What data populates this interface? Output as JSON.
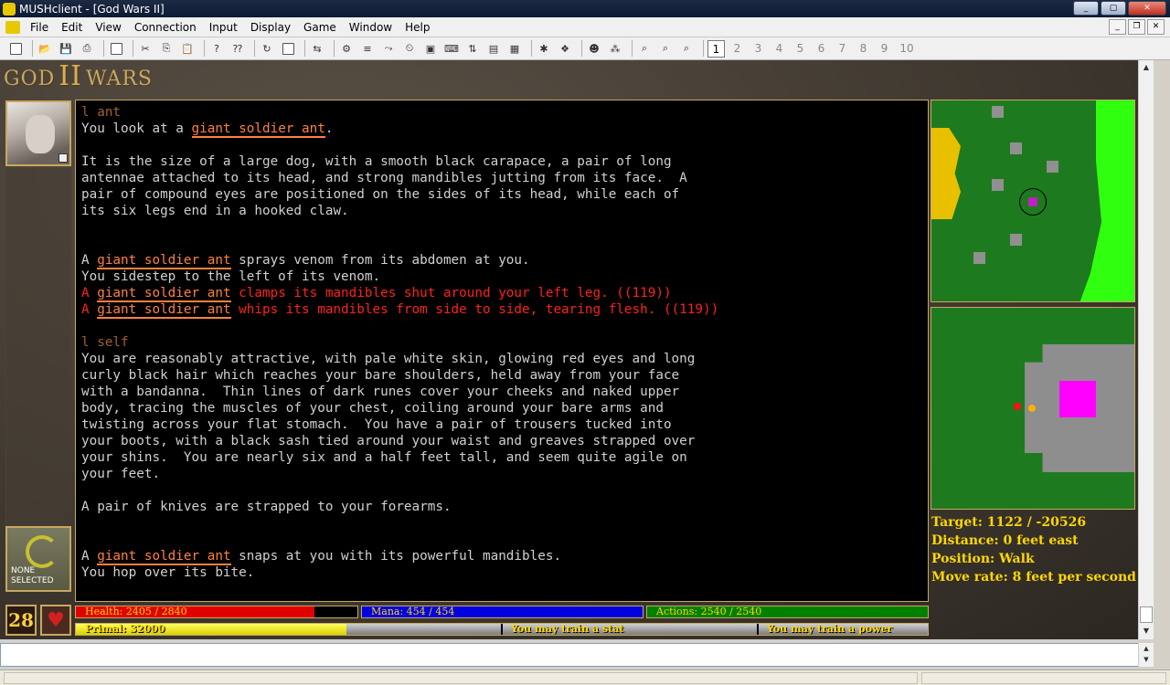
{
  "window": {
    "title": "MUSHclient - [God Wars II]"
  },
  "menu": [
    "File",
    "Edit",
    "View",
    "Connection",
    "Input",
    "Display",
    "Game",
    "Window",
    "Help"
  ],
  "toolbar": {
    "world_numbers": [
      "1",
      "2",
      "3",
      "4",
      "5",
      "6",
      "7",
      "8",
      "9",
      "10"
    ],
    "active_world": "1"
  },
  "logo": {
    "left": "GOD",
    "mid": "II",
    "right": "WARS"
  },
  "selected_panel": {
    "label_line1": "NONE",
    "label_line2": "SELECTED"
  },
  "output": [
    {
      "type": "cmd",
      "text": "l ant"
    },
    {
      "type": "mix",
      "parts": [
        {
          "t": "You look at a "
        },
        {
          "t": "giant soldier ant",
          "hl": true
        },
        {
          "t": "."
        }
      ]
    },
    {
      "type": "blank"
    },
    {
      "type": "plain",
      "text": "It is the size of a large dog, with a smooth black carapace, a pair of long"
    },
    {
      "type": "plain",
      "text": "antennae attached to its head, and strong mandibles jutting from its face.  A"
    },
    {
      "type": "plain",
      "text": "pair of compound eyes are positioned on the sides of its head, while each of"
    },
    {
      "type": "plain",
      "text": "its six legs end in a hooked claw."
    },
    {
      "type": "blank"
    },
    {
      "type": "blank"
    },
    {
      "type": "mix",
      "parts": [
        {
          "t": "A "
        },
        {
          "t": "giant soldier ant",
          "hl": true
        },
        {
          "t": " sprays venom from its abdomen at you."
        }
      ]
    },
    {
      "type": "plain",
      "text": "You sidestep to the left of its venom."
    },
    {
      "type": "redmix",
      "parts": [
        {
          "t": "A "
        },
        {
          "t": "giant soldier ant",
          "hl": true
        },
        {
          "t": " clamps its mandibles shut around your left leg. ((119))"
        }
      ]
    },
    {
      "type": "redmix",
      "parts": [
        {
          "t": "A "
        },
        {
          "t": "giant soldier ant",
          "hl": true
        },
        {
          "t": " whips its mandibles from side to side, tearing flesh. ((119))"
        }
      ]
    },
    {
      "type": "blank"
    },
    {
      "type": "cmd",
      "text": "l self"
    },
    {
      "type": "plain",
      "text": "You are reasonably attractive, with pale white skin, glowing red eyes and long"
    },
    {
      "type": "plain",
      "text": "curly black hair which reaches your bare shoulders, held away from your face"
    },
    {
      "type": "plain",
      "text": "with a bandanna.  Thin lines of dark runes cover your cheeks and naked upper"
    },
    {
      "type": "plain",
      "text": "body, tracing the muscles of your chest, coiling around your bare arms and"
    },
    {
      "type": "plain",
      "text": "twisting across your flat stomach.  You have a pair of trousers tucked into"
    },
    {
      "type": "plain",
      "text": "your boots, with a black sash tied around your waist and greaves strapped over"
    },
    {
      "type": "plain",
      "text": "your shins.  You are nearly six and a half feet tall, and seem quite agile on"
    },
    {
      "type": "plain",
      "text": "your feet."
    },
    {
      "type": "blank"
    },
    {
      "type": "plain",
      "text": "A pair of knives are strapped to your forearms."
    },
    {
      "type": "blank"
    },
    {
      "type": "blank"
    },
    {
      "type": "mix",
      "parts": [
        {
          "t": "A "
        },
        {
          "t": "giant soldier ant",
          "hl": true
        },
        {
          "t": " snaps at you with its powerful mandibles."
        }
      ]
    },
    {
      "type": "plain",
      "text": "You hop over its bite."
    }
  ],
  "info": {
    "target": "Target: 1122 / -20526",
    "distance": "Distance: 0 feet east",
    "position": "Position: Walk",
    "move_rate": "Move rate: 8 feet per second"
  },
  "stats": {
    "level": "28",
    "health": {
      "label": "Health: 2405 / 2840",
      "fraction": 0.847,
      "color": "#e00000"
    },
    "mana": {
      "label": "Mana: 454 / 454",
      "fraction": 1.0,
      "color": "#0000e0"
    },
    "actions": {
      "label": "Actions: 2540 / 2540",
      "fraction": 1.0,
      "color": "#008000"
    },
    "primal": "Primal: 32000",
    "train_stat": "You may train a stat",
    "train_power": "You may train a power"
  },
  "colors": {
    "accent_gold": "#c8a860",
    "highlight": "#ff8040",
    "combat_red": "#ff2020"
  }
}
